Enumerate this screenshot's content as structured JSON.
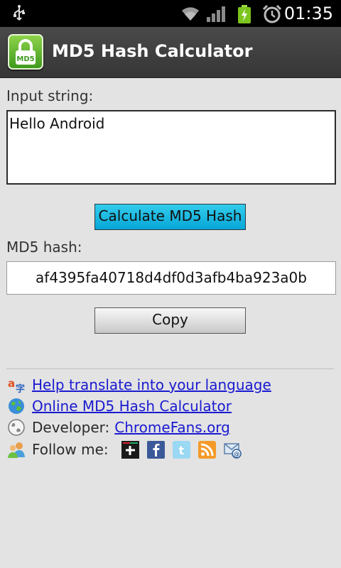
{
  "status_bar": {
    "time": "01:35",
    "icons": [
      "usb-icon",
      "wifi-icon",
      "signal-icon",
      "battery-charging-icon",
      "alarm-icon"
    ]
  },
  "app": {
    "title": "MD5 Hash Calculator",
    "icon": "md5-lock-icon",
    "icon_text": "MD5"
  },
  "form": {
    "input_label": "Input string:",
    "input_value": "Hello Android",
    "calculate_label": "Calculate MD5 Hash",
    "hash_label": "MD5 hash:",
    "hash_value": "af4395fa40718d4df0d3afb4ba923a0b",
    "copy_label": "Copy"
  },
  "links": {
    "translate": "Help translate into your language",
    "online": "Online MD5 Hash Calculator",
    "developer_label": "Developer:",
    "developer_link": "ChromeFans.org",
    "follow_label": "Follow me:",
    "social": [
      "google-plus-icon",
      "facebook-icon",
      "twitter-icon",
      "rss-icon",
      "email-icon"
    ]
  },
  "colors": {
    "calculate_button": "#06a6d7",
    "link": "#1a1ad0",
    "title_bar": "#3c3c3c",
    "background": "#e3e3e3"
  }
}
